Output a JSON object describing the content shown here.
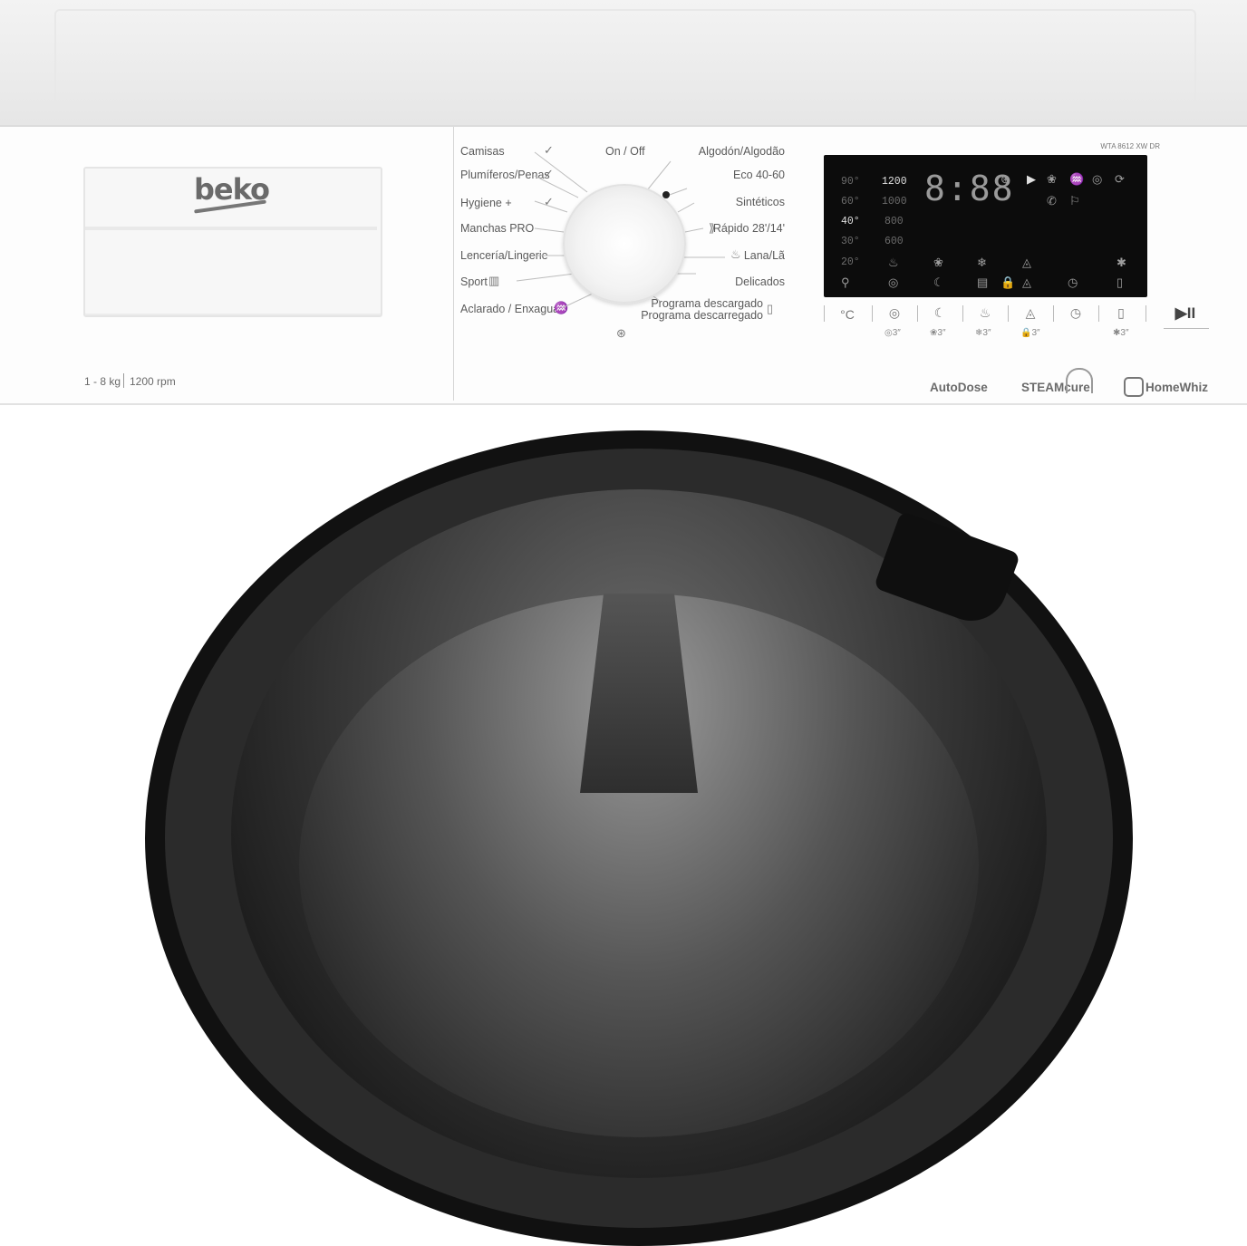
{
  "brand": "beko",
  "capacity": {
    "load": "1 - 8 kg",
    "spin": "1200 rpm"
  },
  "model": "WTA 8612 XW DR",
  "knob": {
    "on_off_label": "On / Off"
  },
  "programs_left": [
    "Camisas",
    "Plumíferos/Penas",
    "Hygiene +",
    "Manchas PRO",
    "Lencería/Lingerie",
    "Sport",
    "Aclarado / Enxaguar"
  ],
  "programs_right": [
    "Algodón/Algodão",
    "Eco 40-60",
    "Sintéticos",
    "Rápido 28'/14'",
    "Lana/Lã",
    "Delicados",
    "Programa descargado",
    "Programa descarregado"
  ],
  "display": {
    "temps": [
      "90°",
      "60°",
      "40°",
      "30°",
      "20°"
    ],
    "speeds": [
      "1200",
      "1000",
      "800",
      "600"
    ],
    "time": "8:88"
  },
  "buttons": [
    {
      "icon": "temperature-icon",
      "glyph": "°C",
      "sub": ""
    },
    {
      "icon": "spin-icon",
      "glyph": "◎",
      "sub": "◎3″"
    },
    {
      "icon": "night-mode-icon",
      "glyph": "☾",
      "sub": "❀3″"
    },
    {
      "icon": "autodose-icon",
      "glyph": "♨",
      "sub": "❄3″"
    },
    {
      "icon": "steam-icon",
      "glyph": "◬",
      "sub": "🔒3″"
    },
    {
      "icon": "timer-icon",
      "glyph": "◷",
      "sub": ""
    },
    {
      "icon": "remote-icon",
      "glyph": "▯",
      "sub": "✱3″"
    },
    {
      "icon": "start-pause-icon",
      "glyph": "▶II",
      "sub": ""
    }
  ],
  "logos": [
    "AutoDose",
    "STEAMcure",
    "HomeWhiz"
  ],
  "colors": {
    "panel": "#fdfdfd",
    "display": "#0c0c0c",
    "door": "#111111",
    "text": "#5a5a5a"
  }
}
